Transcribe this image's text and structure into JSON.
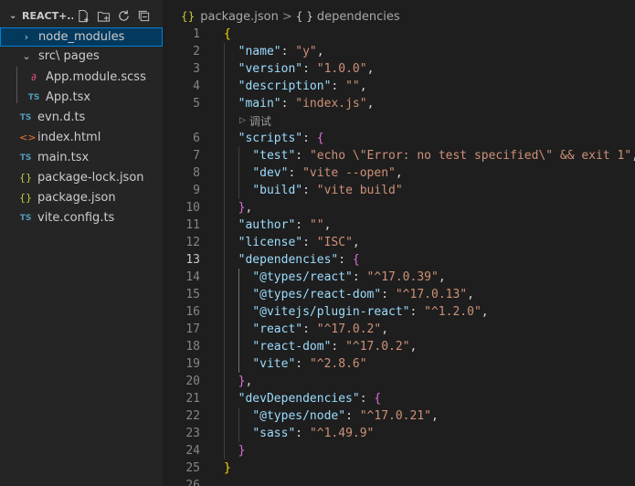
{
  "explorer": {
    "title": "REACT+...",
    "actions": [
      "new-file-icon",
      "new-folder-icon",
      "refresh-icon",
      "collapse-all-icon"
    ],
    "items": [
      {
        "label": "node_modules",
        "icon": "chevron-right-icon",
        "kind": "folder",
        "selected": true
      },
      {
        "label": "src\\ pages",
        "icon": "chevron-down-icon",
        "kind": "folder"
      },
      {
        "label": "App.module.scss",
        "icon": "scss-icon",
        "kind": "file"
      },
      {
        "label": "App.tsx",
        "icon": "ts-icon",
        "kind": "file"
      },
      {
        "label": "evn.d.ts",
        "icon": "ts-icon",
        "kind": "file"
      },
      {
        "label": "index.html",
        "icon": "html-icon",
        "kind": "file"
      },
      {
        "label": "main.tsx",
        "icon": "ts-icon",
        "kind": "file"
      },
      {
        "label": "package-lock.json",
        "icon": "json-icon",
        "kind": "file"
      },
      {
        "label": "package.json",
        "icon": "json-icon",
        "kind": "file"
      },
      {
        "label": "vite.config.ts",
        "icon": "ts-icon",
        "kind": "file"
      }
    ],
    "icon_glyphs": {
      "ts": "TS",
      "json": "{}",
      "html": "<>",
      "scss": "∂"
    }
  },
  "breadcrumb": {
    "file": "package.json",
    "separator": ">",
    "object_icon": "{ }",
    "section": "dependencies"
  },
  "editor": {
    "active_line": 13,
    "codelens_label": "调试",
    "lines": [
      {
        "n": "1",
        "parts": [
          [
            "b1",
            "{"
          ]
        ]
      },
      {
        "n": "2",
        "parts": [
          [
            "p",
            "  "
          ],
          [
            "k",
            "\"name\""
          ],
          [
            "p",
            ": "
          ],
          [
            "s",
            "\"y\""
          ],
          [
            "p",
            ","
          ]
        ]
      },
      {
        "n": "3",
        "parts": [
          [
            "p",
            "  "
          ],
          [
            "k",
            "\"version\""
          ],
          [
            "p",
            ": "
          ],
          [
            "s",
            "\"1.0.0\""
          ],
          [
            "p",
            ","
          ]
        ]
      },
      {
        "n": "4",
        "parts": [
          [
            "p",
            "  "
          ],
          [
            "k",
            "\"description\""
          ],
          [
            "p",
            ": "
          ],
          [
            "s",
            "\"\""
          ],
          [
            "p",
            ","
          ]
        ]
      },
      {
        "n": "5",
        "parts": [
          [
            "p",
            "  "
          ],
          [
            "k",
            "\"main\""
          ],
          [
            "p",
            ": "
          ],
          [
            "s",
            "\"index.js\""
          ],
          [
            "p",
            ","
          ]
        ]
      },
      {
        "n": "6",
        "parts": [
          [
            "p",
            "  "
          ],
          [
            "k",
            "\"scripts\""
          ],
          [
            "p",
            ": "
          ],
          [
            "b2",
            "{"
          ]
        ]
      },
      {
        "n": "7",
        "parts": [
          [
            "p",
            "    "
          ],
          [
            "k",
            "\"test\""
          ],
          [
            "p",
            ": "
          ],
          [
            "s",
            "\"echo \\\"Error: no test specified\\\" && exit 1\""
          ],
          [
            "p",
            ","
          ]
        ]
      },
      {
        "n": "8",
        "parts": [
          [
            "p",
            "    "
          ],
          [
            "k",
            "\"dev\""
          ],
          [
            "p",
            ": "
          ],
          [
            "s",
            "\"vite --open\""
          ],
          [
            "p",
            ","
          ]
        ]
      },
      {
        "n": "9",
        "parts": [
          [
            "p",
            "    "
          ],
          [
            "k",
            "\"build\""
          ],
          [
            "p",
            ": "
          ],
          [
            "s",
            "\"vite build\""
          ]
        ]
      },
      {
        "n": "10",
        "parts": [
          [
            "p",
            "  "
          ],
          [
            "b2",
            "}"
          ],
          [
            "p",
            ","
          ]
        ]
      },
      {
        "n": "11",
        "parts": [
          [
            "p",
            "  "
          ],
          [
            "k",
            "\"author\""
          ],
          [
            "p",
            ": "
          ],
          [
            "s",
            "\"\""
          ],
          [
            "p",
            ","
          ]
        ]
      },
      {
        "n": "12",
        "parts": [
          [
            "p",
            "  "
          ],
          [
            "k",
            "\"license\""
          ],
          [
            "p",
            ": "
          ],
          [
            "s",
            "\"ISC\""
          ],
          [
            "p",
            ","
          ]
        ]
      },
      {
        "n": "13",
        "parts": [
          [
            "p",
            "  "
          ],
          [
            "k",
            "\"dependencies\""
          ],
          [
            "p",
            ": "
          ],
          [
            "b2",
            "{"
          ]
        ]
      },
      {
        "n": "14",
        "parts": [
          [
            "p",
            "    "
          ],
          [
            "k",
            "\"@types/react\""
          ],
          [
            "p",
            ": "
          ],
          [
            "s",
            "\"^17.0.39\""
          ],
          [
            "p",
            ","
          ]
        ]
      },
      {
        "n": "15",
        "parts": [
          [
            "p",
            "    "
          ],
          [
            "k",
            "\"@types/react-dom\""
          ],
          [
            "p",
            ": "
          ],
          [
            "s",
            "\"^17.0.13\""
          ],
          [
            "p",
            ","
          ]
        ]
      },
      {
        "n": "16",
        "parts": [
          [
            "p",
            "    "
          ],
          [
            "k",
            "\"@vitejs/plugin-react\""
          ],
          [
            "p",
            ": "
          ],
          [
            "s",
            "\"^1.2.0\""
          ],
          [
            "p",
            ","
          ]
        ]
      },
      {
        "n": "17",
        "parts": [
          [
            "p",
            "    "
          ],
          [
            "k",
            "\"react\""
          ],
          [
            "p",
            ": "
          ],
          [
            "s",
            "\"^17.0.2\""
          ],
          [
            "p",
            ","
          ]
        ]
      },
      {
        "n": "18",
        "parts": [
          [
            "p",
            "    "
          ],
          [
            "k",
            "\"react-dom\""
          ],
          [
            "p",
            ": "
          ],
          [
            "s",
            "\"^17.0.2\""
          ],
          [
            "p",
            ","
          ]
        ]
      },
      {
        "n": "19",
        "parts": [
          [
            "p",
            "    "
          ],
          [
            "k",
            "\"vite\""
          ],
          [
            "p",
            ": "
          ],
          [
            "s",
            "\"^2.8.6\""
          ]
        ]
      },
      {
        "n": "20",
        "parts": [
          [
            "p",
            "  "
          ],
          [
            "b2",
            "}"
          ],
          [
            "p",
            ","
          ]
        ]
      },
      {
        "n": "21",
        "parts": [
          [
            "p",
            "  "
          ],
          [
            "k",
            "\"devDependencies\""
          ],
          [
            "p",
            ": "
          ],
          [
            "b2",
            "{"
          ]
        ]
      },
      {
        "n": "22",
        "parts": [
          [
            "p",
            "    "
          ],
          [
            "k",
            "\"@types/node\""
          ],
          [
            "p",
            ": "
          ],
          [
            "s",
            "\"^17.0.21\""
          ],
          [
            "p",
            ","
          ]
        ]
      },
      {
        "n": "23",
        "parts": [
          [
            "p",
            "    "
          ],
          [
            "k",
            "\"sass\""
          ],
          [
            "p",
            ": "
          ],
          [
            "s",
            "\"^1.49.9\""
          ]
        ]
      },
      {
        "n": "24",
        "parts": [
          [
            "p",
            "  "
          ],
          [
            "b2",
            "}"
          ]
        ]
      },
      {
        "n": "25",
        "parts": [
          [
            "b1",
            "}"
          ]
        ]
      },
      {
        "n": "26",
        "parts": []
      }
    ]
  },
  "colors": {
    "background": "#1e1e1e",
    "sidebar": "#252526",
    "selection": "#04395e",
    "key": "#9cdcfe",
    "string": "#ce9178",
    "bracket_outer": "#ffd700",
    "bracket_inner": "#da70d6"
  }
}
